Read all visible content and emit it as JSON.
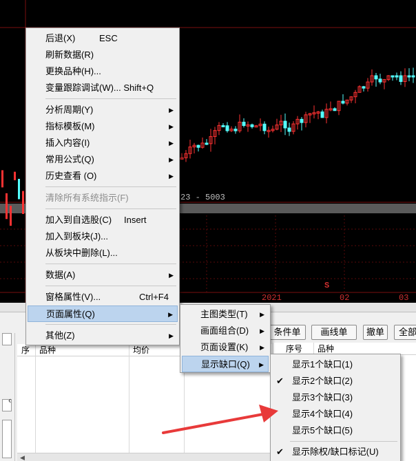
{
  "chart": {
    "price_label": "23 - 5003",
    "date_labels": [
      "2021",
      "02",
      "03"
    ],
    "marker": "S"
  },
  "colors": {
    "up": "#ff3232",
    "down": "#54ffff",
    "highlight": "#bcd4ee"
  },
  "context_menu": {
    "items": [
      {
        "label": "后退(X)",
        "shortcut": "ESC"
      },
      {
        "label": "刷新数据(R)"
      },
      {
        "label": "更换品种(H)..."
      },
      {
        "label": "变量跟踪调试(W)... Shift+Q"
      },
      {
        "label": "分析周期(Y)"
      },
      {
        "label": "指标模板(M)"
      },
      {
        "label": "插入内容(I)"
      },
      {
        "label": "常用公式(Q)"
      },
      {
        "label": "历史查看 (O)"
      },
      {
        "label": "清除所有系统指示(F)"
      },
      {
        "label": "加入到自选股(C)",
        "shortcut": "Insert"
      },
      {
        "label": "加入到板块(J)..."
      },
      {
        "label": "从板块中删除(L)..."
      },
      {
        "label": "数据(A)"
      },
      {
        "label": "窗格属性(V)...",
        "shortcut": "Ctrl+F4"
      },
      {
        "label": "页面属性(Q)"
      },
      {
        "label": "其他(Z)"
      }
    ]
  },
  "page_props_submenu": {
    "items": [
      "主图类型(T)",
      "画面组合(D)",
      "页面设置(K)",
      "显示缺口(Q)"
    ]
  },
  "gap_submenu": {
    "items": [
      "显示1个缺口(1)",
      "显示2个缺口(2)",
      "显示3个缺口(3)",
      "显示4个缺口(4)",
      "显示5个缺口(5)",
      "显示除权/缺口标记(U)"
    ]
  },
  "toolbar": {
    "buttons": [
      "条件单",
      "画线单",
      "撤单",
      "全部"
    ]
  },
  "left_grid": {
    "headers": [
      "序",
      "品种",
      "均价"
    ]
  },
  "right_grid": {
    "headers": [
      "序号",
      "品种"
    ]
  }
}
